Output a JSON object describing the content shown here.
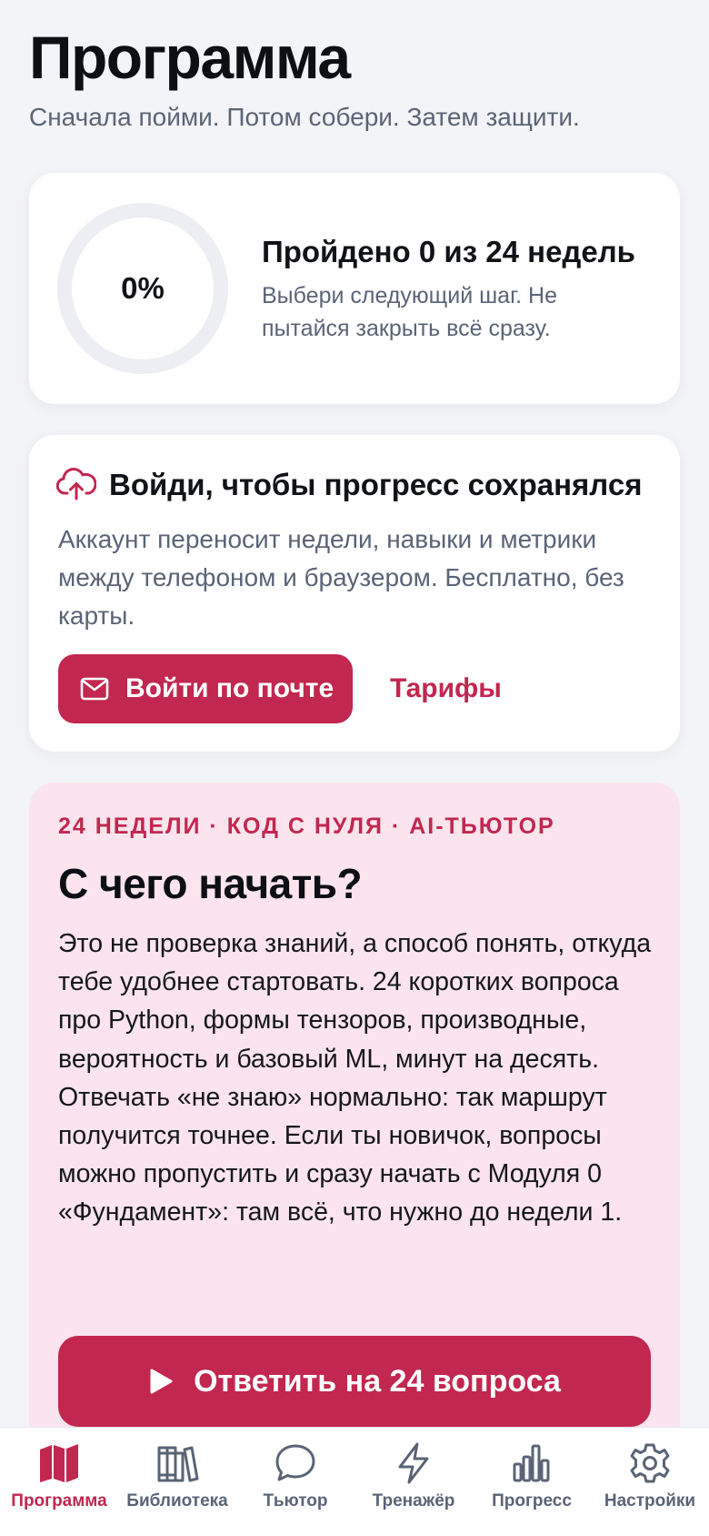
{
  "header": {
    "title": "Программа",
    "subtitle": "Сначала пойми. Потом собери. Затем защити."
  },
  "progress": {
    "percent_label": "0%",
    "percent_value": 0,
    "title": "Пройдено 0 из 24 недель",
    "hint": "Выбери следующий шаг. Не пытайся закрыть всё сразу."
  },
  "login": {
    "icon": "cloud-upload-icon",
    "title": "Войди, чтобы прогресс сохранялся",
    "text": "Аккаунт переносит недели, навыки и метрики между телефоном и браузером. Бесплатно, без карты.",
    "button_label": "Войти по почте",
    "button_icon": "mail-icon",
    "link_label": "Тарифы"
  },
  "start": {
    "eyebrow": "24 НЕДЕЛИ · КОД С НУЛЯ · AI-ТЬЮТОР",
    "title": "С чего начать?",
    "text": "Это не проверка знаний, а способ понять, откуда тебе удобнее стартовать. 24 коротких вопроса про Python, формы тензоров, производные, вероятность и базовый ML, минут на десять. Отвечать «не знаю» нормально: так маршрут получится точнее. Если ты новичок, вопросы можно пропустить и сразу начать с Модуля 0 «Фундамент»: там всё, что нужно до недели 1.",
    "button_label": "Ответить на 24 вопроса",
    "button_icon": "play-icon"
  },
  "nav": {
    "items": [
      {
        "label": "Программа",
        "icon": "map-icon",
        "active": true
      },
      {
        "label": "Библиотека",
        "icon": "books-icon",
        "active": false
      },
      {
        "label": "Тьютор",
        "icon": "chat-bubble-icon",
        "active": false
      },
      {
        "label": "Тренажёр",
        "icon": "lightning-icon",
        "active": false
      },
      {
        "label": "Прогресс",
        "icon": "bar-chart-icon",
        "active": false
      },
      {
        "label": "Настройки",
        "icon": "gear-icon",
        "active": false
      }
    ]
  },
  "colors": {
    "accent": "#c2274f",
    "accent_soft": "#fbe4ed",
    "background": "#f3f4f7",
    "muted_text": "#5a6476"
  }
}
